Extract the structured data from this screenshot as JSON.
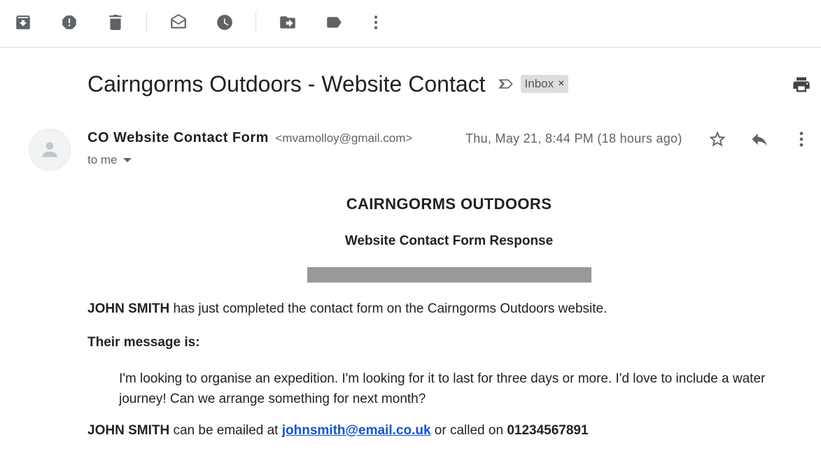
{
  "toolbar": {
    "buttons": [
      "archive-icon",
      "report-spam-icon",
      "delete-icon",
      "mark-unread-icon",
      "snooze-icon",
      "move-to-icon",
      "labels-icon",
      "more-icon"
    ]
  },
  "email": {
    "subject": "Cairngorms Outdoors - Website Contact",
    "label": "Inbox",
    "label_close": "×",
    "sender_name": "CO Website Contact Form",
    "sender_email": "<mvamolloy@gmail.com>",
    "recipient": "to me",
    "date": "Thu, May 21, 8:44 PM (18 hours ago)"
  },
  "body": {
    "title": "CAIRNGORMS OUTDOORS",
    "subtitle": "Website Contact Form Response",
    "name": "JOHN SMITH",
    "intro_rest": " has just completed the contact form on the Cairngorms Outdoors website.",
    "message_heading": "Their message is:",
    "message": "I'm looking to organise an expedition. I'm looking for it to last for three days or more. I'd love to include a water journey! Can we arrange something for next month?",
    "name2": "JOHN SMITH",
    "contact_mid": " can be emailed at ",
    "contact_email": "johnsmith@email.co.uk",
    "contact_mid2": " or called on ",
    "phone": "01234567891"
  },
  "colors": {
    "link": "#1155cc",
    "label_bg": "#dddddd",
    "redaction_bar": "#999999"
  }
}
